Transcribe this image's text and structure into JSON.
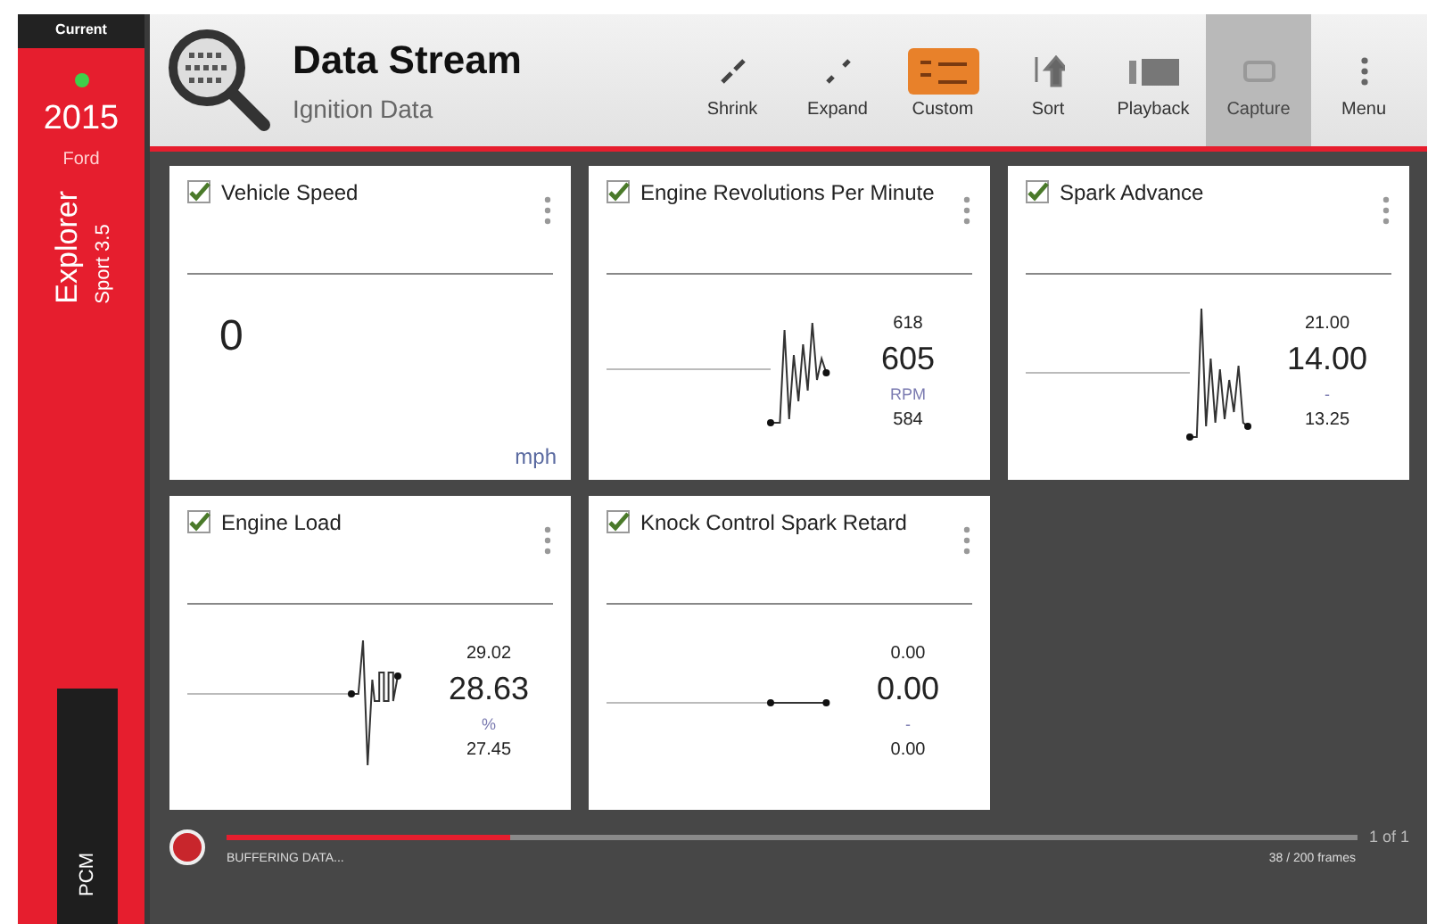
{
  "sidebar": {
    "tab": "Current",
    "year": "2015",
    "make": "Ford",
    "model": "Explorer",
    "trim": "Sport 3.5",
    "module": "PCM"
  },
  "header": {
    "title": "Data Stream",
    "subtitle": "Ignition Data"
  },
  "toolbar": [
    {
      "label": "Shrink",
      "highlighted": false,
      "disabled": false
    },
    {
      "label": "Expand",
      "highlighted": false,
      "disabled": false
    },
    {
      "label": "Custom",
      "highlighted": true,
      "disabled": false
    },
    {
      "label": "Sort",
      "highlighted": false,
      "disabled": false
    },
    {
      "label": "Playback",
      "highlighted": false,
      "disabled": false
    },
    {
      "label": "Capture",
      "highlighted": false,
      "disabled": true
    },
    {
      "label": "Menu",
      "highlighted": false,
      "disabled": false
    }
  ],
  "cards": [
    {
      "kind": "plain",
      "title": "Vehicle Speed",
      "checked": true,
      "value": "0",
      "unit": "mph"
    },
    {
      "kind": "graph",
      "title": "Engine Revolutions Per Minute",
      "checked": true,
      "max": "618",
      "value": "605",
      "unit": "RPM",
      "min": "584"
    },
    {
      "kind": "graph",
      "title": "Spark Advance",
      "checked": true,
      "max": "21.00",
      "value": "14.00",
      "unit": "-",
      "min": "13.25"
    },
    {
      "kind": "graph",
      "title": "Engine Load",
      "checked": true,
      "max": "29.02",
      "value": "28.63",
      "unit": "%",
      "min": "27.45"
    },
    {
      "kind": "graph",
      "title": "Knock Control Spark Retard",
      "checked": true,
      "max": "0.00",
      "value": "0.00",
      "unit": "-",
      "min": "0.00"
    }
  ],
  "footer": {
    "status": "BUFFERING DATA...",
    "level": 0.25,
    "page": "1 of 1",
    "frames": "38 / 200 frames"
  }
}
